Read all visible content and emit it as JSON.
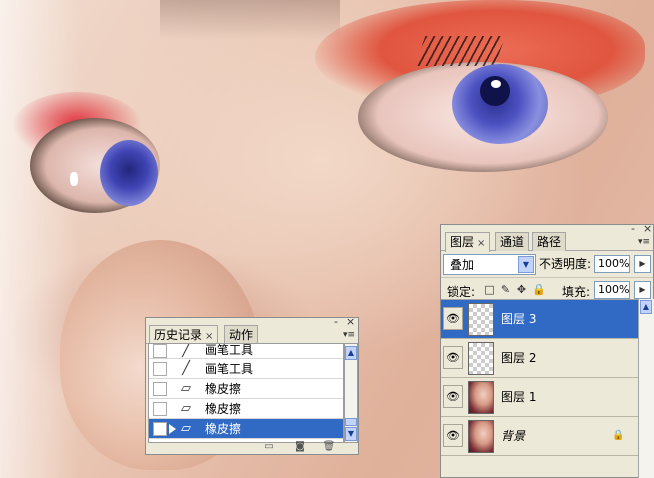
{
  "history_panel": {
    "tabs": [
      "历史记录",
      "动作"
    ],
    "tab_close": "×",
    "min_btn": "-",
    "close_btn": "×",
    "menu_btn": "▾≡",
    "items": [
      {
        "label": "画笔工具",
        "tool": "brush-icon",
        "glyph": "╱"
      },
      {
        "label": "画笔工具",
        "tool": "brush-icon",
        "glyph": "╱"
      },
      {
        "label": "橡皮擦",
        "tool": "eraser-icon",
        "glyph": "▱"
      },
      {
        "label": "橡皮擦",
        "tool": "eraser-icon",
        "glyph": "▱"
      },
      {
        "label": "橡皮擦",
        "tool": "eraser-icon",
        "glyph": "▱",
        "selected": true
      }
    ],
    "scroll_up": "▲",
    "scroll_down": "▼",
    "bottom_icons": {
      "new_document": "▭",
      "snapshot": "◙",
      "delete": "🗑"
    }
  },
  "layers_panel": {
    "tabs": [
      "图层",
      "通道",
      "路径"
    ],
    "tab_close": "×",
    "min_btn": "-",
    "close_btn": "×",
    "menu_btn": "▾≡",
    "blend_mode": "叠加",
    "opacity_label": "不透明度:",
    "opacity_value": "100%",
    "lock_label": "锁定:",
    "lock_icons": {
      "transparent": "□",
      "brush": "✎",
      "move": "✥",
      "all": "🔒"
    },
    "fill_label": "填充:",
    "fill_value": "100%",
    "flyout": "▶",
    "select_arrow": "▼",
    "eye_glyph": "👁",
    "layers": [
      {
        "name": "图层 3",
        "thumb": "transparent",
        "selected": true
      },
      {
        "name": "图层 2",
        "thumb": "transparent"
      },
      {
        "name": "图层 1",
        "thumb": "face"
      },
      {
        "name": "背景",
        "thumb": "face",
        "locked": true,
        "lock_glyph": "🔒"
      }
    ],
    "scroll_up": "▲",
    "scroll_down": "▼"
  },
  "colors": {
    "selection": "#316ac5",
    "panel_bg": "#ece9d8"
  }
}
